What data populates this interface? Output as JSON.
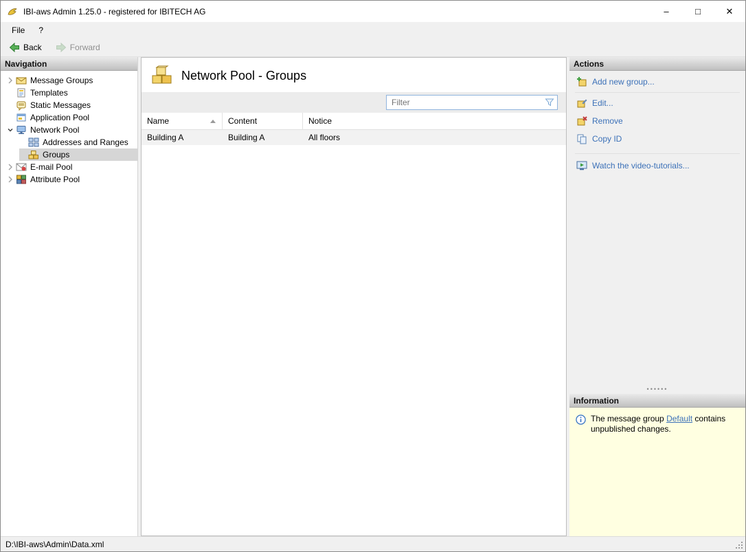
{
  "window": {
    "title": "IBI-aws Admin 1.25.0 - registered for IBITECH AG",
    "controls": {
      "minimize": "–",
      "maximize": "□",
      "close": "✕"
    }
  },
  "menu": {
    "file": "File",
    "help": "?"
  },
  "toolbar": {
    "back": "Back",
    "forward": "Forward"
  },
  "navigation": {
    "header": "Navigation",
    "items": [
      {
        "label": "Message Groups"
      },
      {
        "label": "Templates"
      },
      {
        "label": "Static Messages"
      },
      {
        "label": "Application Pool"
      },
      {
        "label": "Network Pool"
      },
      {
        "label": "Addresses and Ranges"
      },
      {
        "label": "Groups"
      },
      {
        "label": "E-mail Pool"
      },
      {
        "label": "Attribute Pool"
      }
    ]
  },
  "main": {
    "title": "Network Pool - Groups",
    "filter_placeholder": "Filter",
    "table": {
      "columns": [
        "Name",
        "Content",
        "Notice"
      ],
      "sort_column": "Name",
      "sort_direction": "ascending",
      "rows": [
        [
          "Building A",
          "Building A",
          "All floors"
        ]
      ]
    }
  },
  "actions": {
    "header": "Actions",
    "items": [
      {
        "label": "Add new group..."
      },
      {
        "label": "Edit..."
      },
      {
        "label": "Remove"
      },
      {
        "label": "Copy ID"
      },
      {
        "label": "Watch the video-tutorials..."
      }
    ]
  },
  "information": {
    "header": "Information",
    "text_before": "The message group ",
    "link_label": "Default",
    "text_after": " contains unpublished changes."
  },
  "statusbar": {
    "path": "D:\\IBI-aws\\Admin\\Data.xml"
  }
}
